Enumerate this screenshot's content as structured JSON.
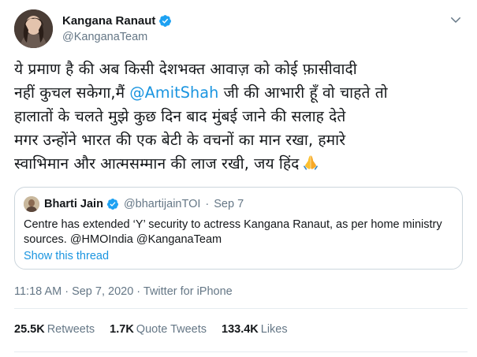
{
  "author": {
    "name": "Kangana Ranaut",
    "handle": "@KanganaTeam",
    "verified": true
  },
  "tweet": {
    "line1": "ये प्रमाण है की अब किसी देशभक्त आवाज़ को कोई फ़ासीवादी",
    "line2_pre": "नहीं कुचल सकेगा,मैं ",
    "line2_mention": "@AmitShah",
    "line2_post": " जी की आभारी हूँ वो चाहते तो",
    "line3": "हालातों के चलते मुझे कुछ दिन बाद मुंबई जाने की सलाह देते",
    "line4": "मगर उन्होंने भारत की एक बेटी के वचनों का मान रखा, हमारे",
    "line5": "स्वाभिमान और आत्मसम्मान की लाज रखी, जय हिंद",
    "emoji": "folded-hands-emoji"
  },
  "quoted": {
    "name": "Bharti Jain",
    "verified": true,
    "handle": "@bhartijainTOI",
    "separator": "·",
    "date": "Sep 7",
    "body_line1": "Centre has extended ‘Y’ security to actress Kangana Ranaut, as per home ministry",
    "body_line2": "sources. @HMOIndia @KanganaTeam",
    "show_thread": "Show this thread"
  },
  "meta": {
    "timestamp": "11:18 AM · Sep 7, 2020 · Twitter for iPhone"
  },
  "stats": {
    "retweets_count": "25.5K",
    "retweets_label": "Retweets",
    "quotes_count": "1.7K",
    "quotes_label": "Quote Tweets",
    "likes_count": "133.4K",
    "likes_label": "Likes"
  },
  "colors": {
    "accent": "#1b95e0",
    "secondary_text": "#657786",
    "border": "#ccd6dd"
  }
}
